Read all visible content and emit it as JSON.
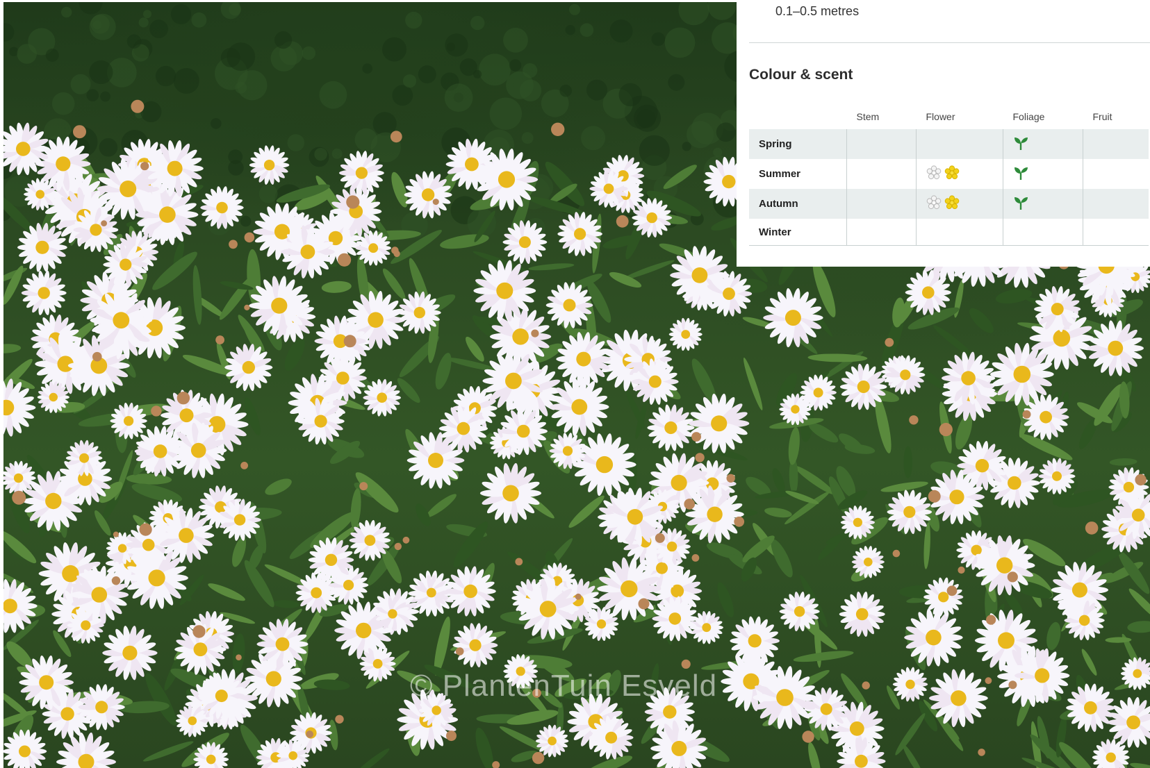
{
  "height": {
    "value": "0.1–0.5 metres"
  },
  "colour_scent": {
    "title": "Colour & scent",
    "columns": [
      "Stem",
      "Flower",
      "Foliage",
      "Fruit"
    ],
    "rows": [
      {
        "season": "Spring",
        "stem": "",
        "flower": [],
        "foliage": [
          "leaf-icon"
        ],
        "fruit": ""
      },
      {
        "season": "Summer",
        "stem": "",
        "flower": [
          "white-flower-icon",
          "yellow-flower-icon"
        ],
        "foliage": [
          "leaf-icon"
        ],
        "fruit": ""
      },
      {
        "season": "Autumn",
        "stem": "",
        "flower": [
          "white-flower-icon",
          "yellow-flower-icon"
        ],
        "foliage": [
          "leaf-icon"
        ],
        "fruit": ""
      },
      {
        "season": "Winter",
        "stem": "",
        "flower": [],
        "foliage": [],
        "fruit": ""
      }
    ]
  },
  "colors": {
    "foliage_green": "#2e8b3a",
    "flower_yellow": "#f2d21b",
    "flower_white": "#f4f4f4",
    "row_stripe": "#e9eeee"
  },
  "watermark": "© PlantenTuin Esveld"
}
